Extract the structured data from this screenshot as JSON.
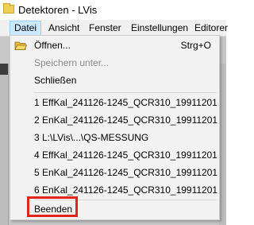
{
  "window": {
    "title": "Detektoren - LVis"
  },
  "menubar": {
    "items": [
      {
        "label": "Datei"
      },
      {
        "label": "Ansicht"
      },
      {
        "label": "Fenster"
      },
      {
        "label": "Einstellungen"
      },
      {
        "label": "Editorer"
      }
    ]
  },
  "file_menu": {
    "open_label": "Öffnen...",
    "open_shortcut": "Strg+O",
    "save_as_label": "Speichern unter...",
    "close_label": "Schließen",
    "recent": [
      "1 EffKal_241126-1245_QCR310_19911201",
      "2 EnKal_241126-1245_QCR310_19911201",
      "3 L:\\LVis\\...\\QS-MESSUNG",
      "4 EffKal_241126-1245_QCR310_19911201",
      "5 EnKal_241126-1245_QCR310_19911201",
      "6 EnKal_241126-1245_QCR310_19911201"
    ],
    "exit_label": "Beenden"
  },
  "colors": {
    "highlight": "#e3241b",
    "menu_active": "#cce8ff",
    "disabled_text": "#8c8c8c"
  },
  "icons": {
    "app": "folder-icon",
    "open": "open-folder-icon"
  }
}
